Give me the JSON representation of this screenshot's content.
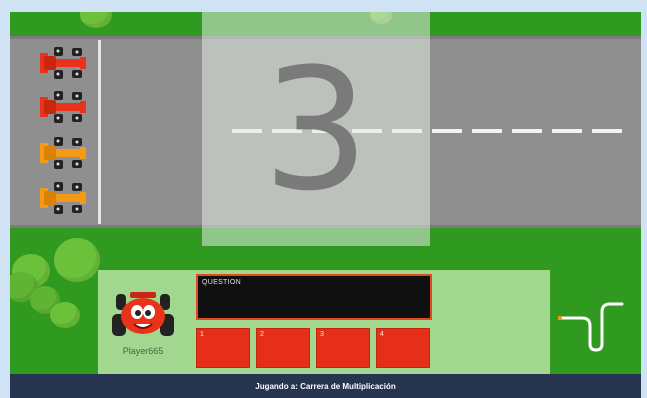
{
  "game": {
    "countdown": "3",
    "question_label": "QUESTION",
    "answers": [
      "1",
      "2",
      "3",
      "4"
    ],
    "player_name": "Player665",
    "footer_text": "Jugando a: Carrera de Multiplicación"
  },
  "colors": {
    "grass": "#2f9a1f",
    "road": "#8f8f8f",
    "answer_button": "#e62f19",
    "question_border": "#e24a1c",
    "footer": "#26344f",
    "car_red": "#e8331a",
    "car_orange": "#f39a17"
  },
  "cars": [
    {
      "color": "red"
    },
    {
      "color": "red"
    },
    {
      "color": "orange"
    },
    {
      "color": "orange"
    }
  ],
  "icons": {
    "avatar": "red-race-car-mascot-icon",
    "track_map": "track-minimap-icon"
  }
}
